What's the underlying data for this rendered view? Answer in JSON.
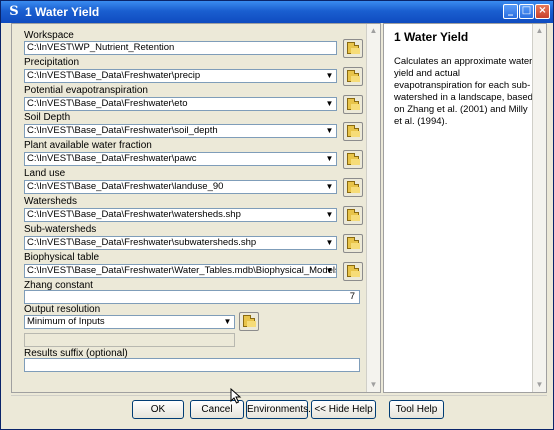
{
  "window": {
    "title": "1 Water Yield",
    "app_icon": "S",
    "controls": {
      "minimize": "_",
      "maximize": "□",
      "close": "×"
    }
  },
  "form": {
    "workspace": {
      "label": "Workspace",
      "value": "C:\\InVEST\\WP_Nutrient_Retention"
    },
    "precipitation": {
      "label": "Precipitation",
      "value": "C:\\InVEST\\Base_Data\\Freshwater\\precip"
    },
    "pet": {
      "label": "Potential evapotranspiration",
      "value": "C:\\InVEST\\Base_Data\\Freshwater\\eto"
    },
    "soil_depth": {
      "label": "Soil Depth",
      "value": "C:\\InVEST\\Base_Data\\Freshwater\\soil_depth"
    },
    "pawc": {
      "label": "Plant available water fraction",
      "value": "C:\\InVEST\\Base_Data\\Freshwater\\pawc"
    },
    "land_use": {
      "label": "Land use",
      "value": "C:\\InVEST\\Base_Data\\Freshwater\\landuse_90"
    },
    "watersheds": {
      "label": "Watersheds",
      "value": "C:\\InVEST\\Base_Data\\Freshwater\\watersheds.shp"
    },
    "subwatersheds": {
      "label": "Sub-watersheds",
      "value": "C:\\InVEST\\Base_Data\\Freshwater\\subwatersheds.shp"
    },
    "biophysical": {
      "label": "Biophysical table",
      "value": "C:\\InVEST\\Base_Data\\Freshwater\\Water_Tables.mdb\\Biophysical_Models"
    },
    "zhang": {
      "label": "Zhang constant",
      "value": "7"
    },
    "output_resolution": {
      "label": "Output resolution",
      "value": "Minimum of Inputs"
    },
    "results_suffix": {
      "label": "Results suffix (optional)",
      "value": ""
    }
  },
  "help": {
    "title": "1 Water Yield",
    "text": "Calculates an approximate water yield and actual evapotranspiration for each sub-watershed in a landscape, based on Zhang et al. (2001) and Milly et al. (1994)."
  },
  "buttons": {
    "ok": "OK",
    "cancel": "Cancel",
    "environments": "Environments...",
    "hide_help": "<< Hide Help",
    "tool_help": "Tool Help"
  },
  "icons": {
    "folder": "open-folder-icon",
    "dropdown": "chevron-down-icon",
    "scroll_up": "▲",
    "scroll_down": "▼"
  }
}
